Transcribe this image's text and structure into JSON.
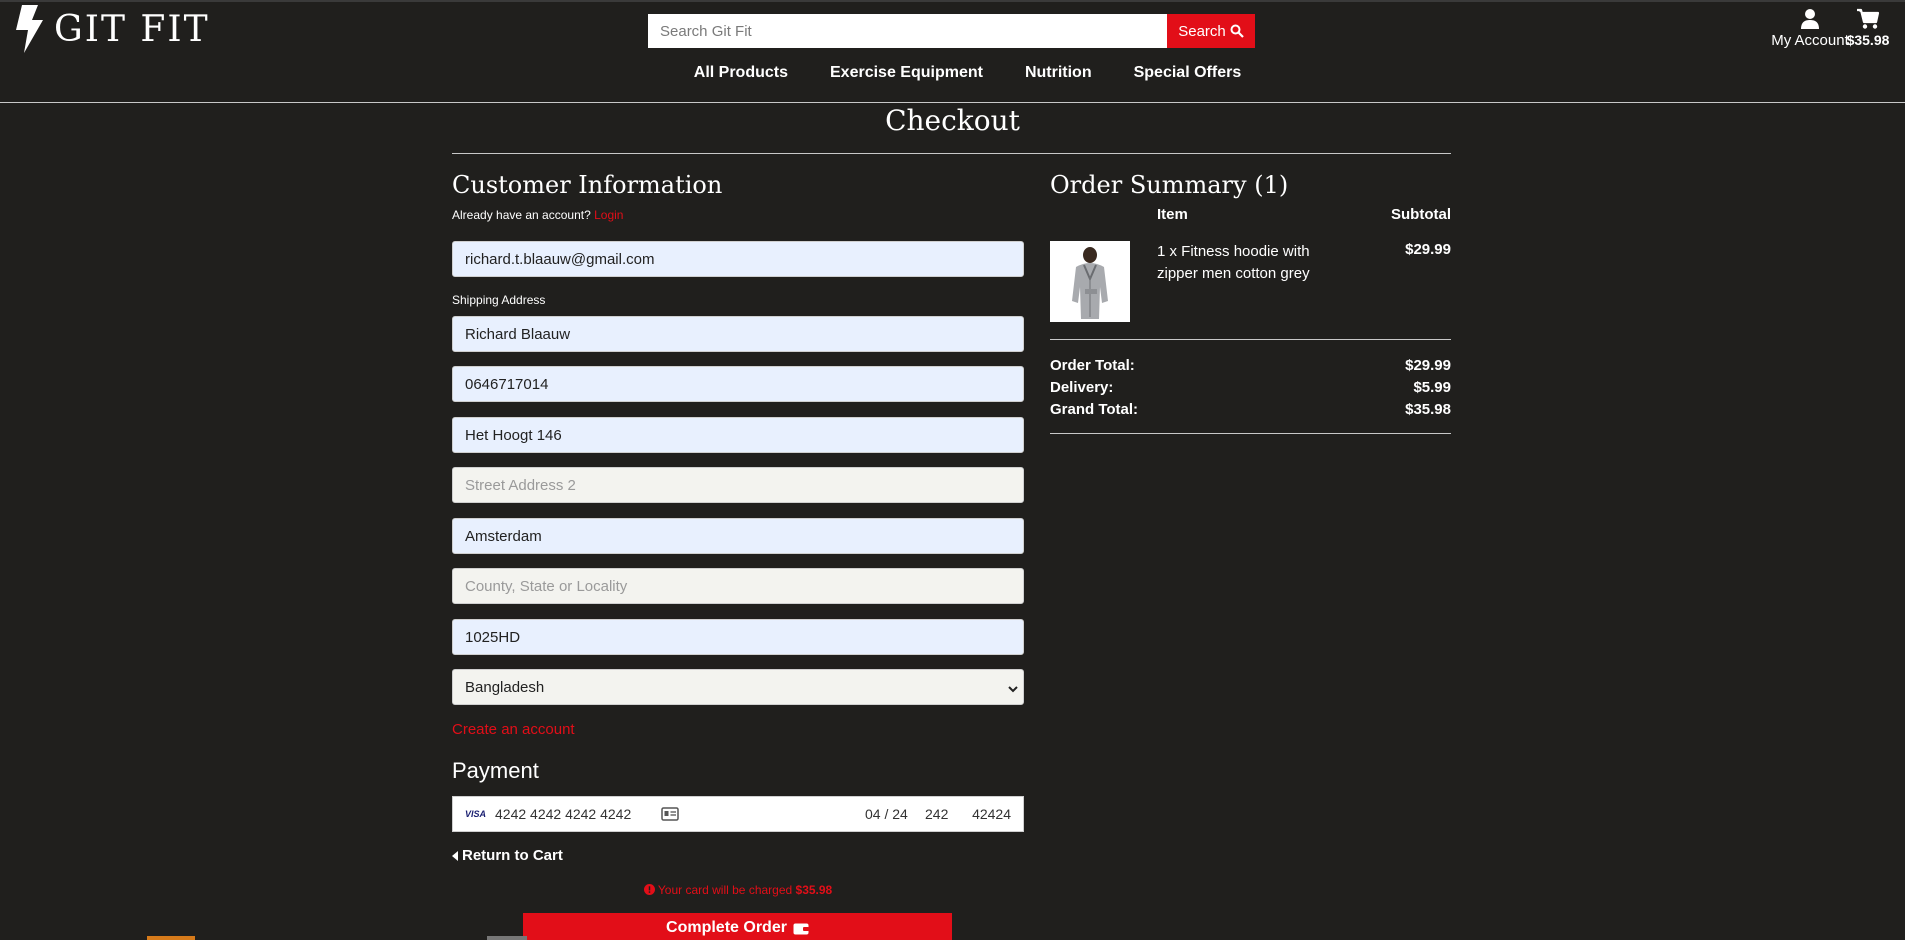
{
  "header": {
    "brand": "GIT FIT",
    "search": {
      "placeholder": "Search Git Fit",
      "button_label": "Search"
    },
    "account_label": "My Account",
    "cart_total": "$35.98",
    "nav": [
      "All Products",
      "Exercise Equipment",
      "Nutrition",
      "Special Offers"
    ]
  },
  "checkout": {
    "title": "Checkout",
    "customer": {
      "heading": "Customer Information",
      "already_text": "Already have an account?",
      "login_label": "Login",
      "email": "richard.t.blaauw@gmail.com",
      "shipping_label": "Shipping Address",
      "full_name": "Richard Blaauw",
      "phone": "0646717014",
      "street1": "Het Hoogt 146",
      "street2_placeholder": "Street Address 2",
      "town": "Amsterdam",
      "county_placeholder": "County, State or Locality",
      "postcode": "1025HD",
      "country": "Bangladesh",
      "create_account_label": "Create an account"
    },
    "payment": {
      "heading": "Payment",
      "card_brand": "VISA",
      "card_number": "4242 4242 4242 4242",
      "expiry": "04 / 24",
      "cvc": "242",
      "zip": "42424"
    },
    "return_label": "Return to Cart",
    "charge_text": "Your card will be charged",
    "charge_amount": "$35.98",
    "complete_label": "Complete Order"
  },
  "summary": {
    "heading": "Order Summary (1)",
    "col_item": "Item",
    "col_subtotal": "Subtotal",
    "items": [
      {
        "description": "1 x Fitness hoodie with zipper men cotton grey",
        "subtotal": "$29.99"
      }
    ],
    "order_total_label": "Order Total:",
    "order_total": "$29.99",
    "delivery_label": "Delivery:",
    "delivery": "$5.99",
    "grand_total_label": "Grand Total:",
    "grand_total": "$35.98"
  },
  "colors": {
    "background": "#201f1d",
    "accent": "#e20e18",
    "autofill": "#e8f0fe"
  },
  "icons": [
    "bolt-logo-icon",
    "search-icon",
    "user-icon",
    "cart-icon",
    "chevron-down-icon",
    "id-card-icon",
    "caret-left-icon",
    "exclamation-circle-icon",
    "wallet-icon"
  ]
}
